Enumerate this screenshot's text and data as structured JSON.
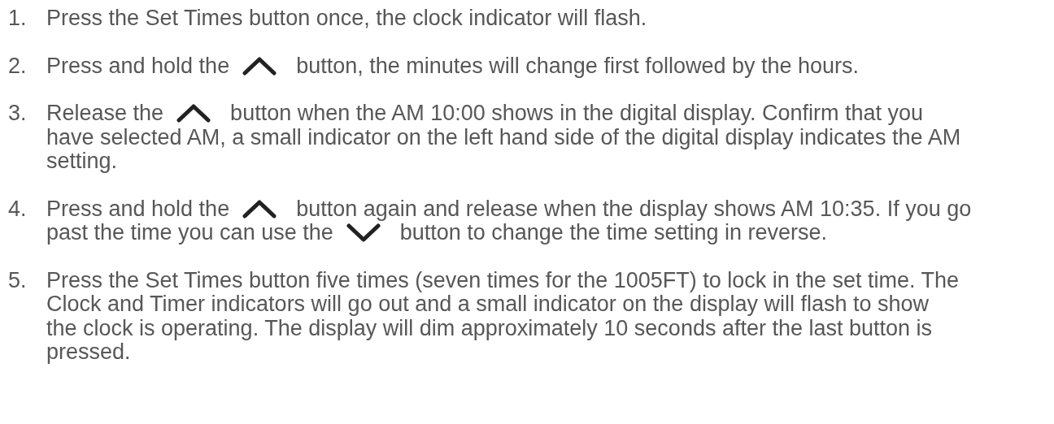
{
  "steps": [
    {
      "number": "1.",
      "lines": [
        [
          {
            "kind": "text",
            "text": "Press the Set Times button once, the clock indicator will flash."
          }
        ]
      ]
    },
    {
      "number": "2.",
      "lines": [
        [
          {
            "kind": "text",
            "text": "Press and hold the"
          },
          {
            "kind": "up-chevron"
          },
          {
            "kind": "text",
            "text": "button, the minutes will change first followed by the hours."
          }
        ]
      ]
    },
    {
      "number": "3.",
      "lines": [
        [
          {
            "kind": "text",
            "text": "Release the"
          },
          {
            "kind": "up-chevron"
          },
          {
            "kind": "text",
            "text": "button when the AM 10:00 shows in the digital display. Confirm that you"
          }
        ],
        [
          {
            "kind": "text",
            "text": "have selected AM, a small indicator on the left hand side of the digital display indicates the AM"
          }
        ],
        [
          {
            "kind": "text",
            "text": "setting."
          }
        ]
      ]
    },
    {
      "number": "4.",
      "lines": [
        [
          {
            "kind": "text",
            "text": "Press and hold the"
          },
          {
            "kind": "up-chevron"
          },
          {
            "kind": "text",
            "text": "button again and release when the display shows AM 10:35. If you go"
          }
        ],
        [
          {
            "kind": "text",
            "text": "past the time you can use the"
          },
          {
            "kind": "down-chevron"
          },
          {
            "kind": "text",
            "text": "button to change the time setting in reverse."
          }
        ]
      ]
    },
    {
      "number": "5.",
      "lines": [
        [
          {
            "kind": "text",
            "text": "Press the Set Times button five times (seven times for the 1005FT) to lock in the set time. The"
          }
        ],
        [
          {
            "kind": "text",
            "text": "Clock and Timer indicators will go out and a small indicator on the display will flash to show"
          }
        ],
        [
          {
            "kind": "text",
            "text": "the clock is operating. The display will dim approximately 10 seconds after the last button is"
          }
        ],
        [
          {
            "kind": "text",
            "text": "pressed."
          }
        ]
      ]
    }
  ]
}
